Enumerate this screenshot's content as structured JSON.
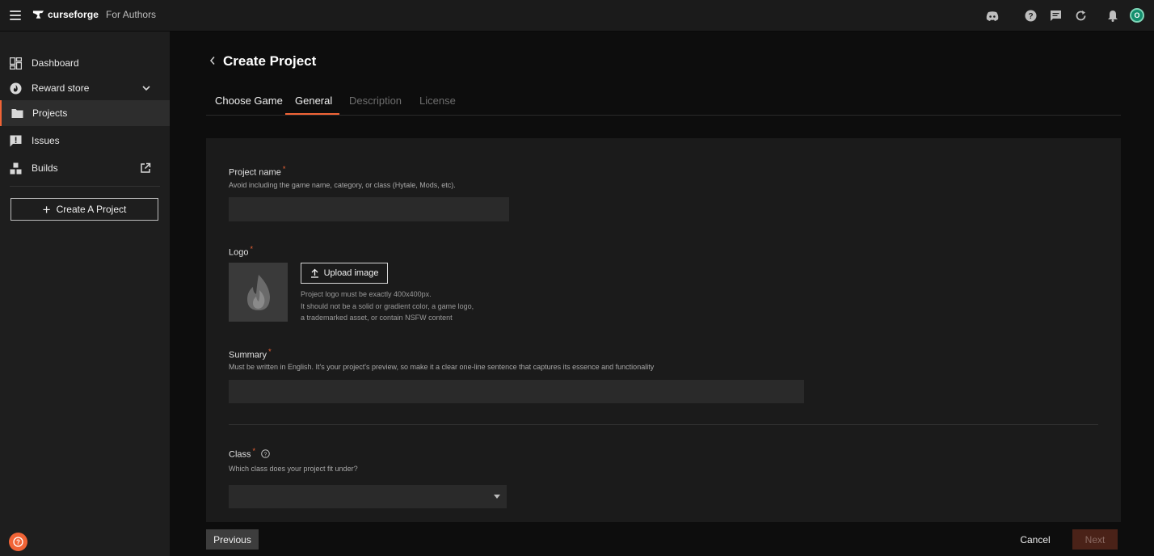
{
  "header": {
    "brand_name": "curseforge",
    "brand_sub": "For Authors",
    "avatar_initial": "O",
    "accent_color": "#f16436"
  },
  "sidebar": {
    "items": [
      {
        "label": "Dashboard",
        "icon": "dashboard-icon"
      },
      {
        "label": "Reward store",
        "icon": "reward-store-icon",
        "trail": "chevron-down-icon"
      },
      {
        "label": "Projects",
        "icon": "folder-icon",
        "active": true
      },
      {
        "label": "Issues",
        "icon": "issues-icon"
      },
      {
        "label": "Builds",
        "icon": "builds-icon",
        "trail": "external-link-icon"
      }
    ],
    "create_project_label": "Create A Project"
  },
  "page": {
    "title": "Create Project",
    "tabs": [
      {
        "label": "Choose Game",
        "state": "done"
      },
      {
        "label": "General",
        "state": "active"
      },
      {
        "label": "Description",
        "state": "pending"
      },
      {
        "label": "License",
        "state": "pending"
      }
    ]
  },
  "form": {
    "project_name": {
      "label": "Project name",
      "required": "*",
      "help": "Avoid including the game name, category, or class (Hytale, Mods, etc).",
      "value": ""
    },
    "logo": {
      "label": "Logo",
      "required": "*",
      "upload_label": "Upload image",
      "note_1": "Project logo must be exactly 400x400px.",
      "note_2": "It should not be a solid or gradient color, a game logo,",
      "note_3": "a trademarked asset, or contain NSFW content"
    },
    "summary": {
      "label": "Summary",
      "required": "*",
      "help": "Must be written in English. It's your project's preview, so make it a clear one-line sentence that captures its essence and functionality",
      "value": ""
    },
    "class": {
      "label": "Class",
      "required": "*",
      "help": "Which class does your project fit under?",
      "value": ""
    }
  },
  "footer": {
    "previous_label": "Previous",
    "cancel_label": "Cancel",
    "next_label": "Next"
  }
}
